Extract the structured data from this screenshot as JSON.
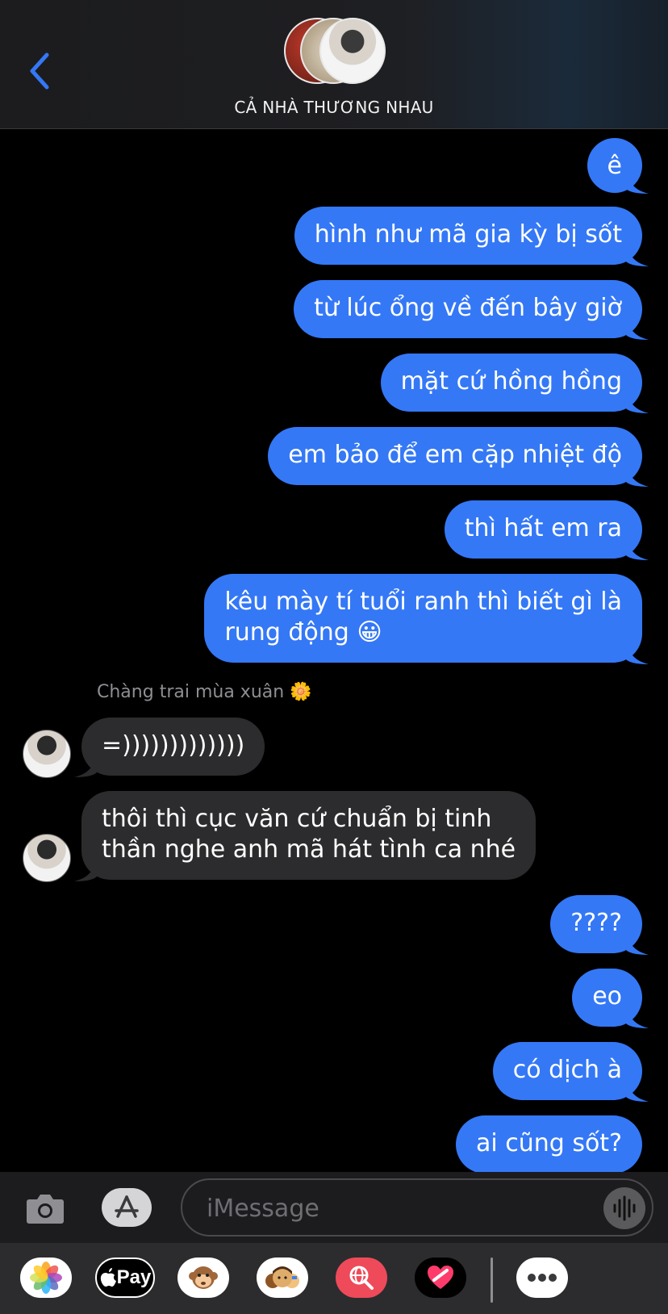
{
  "header": {
    "title": "CẢ NHÀ THƯƠNG NHAU"
  },
  "messages": [
    {
      "dir": "out",
      "text": "ê"
    },
    {
      "dir": "out",
      "text": "hình như mã gia kỳ bị sốt"
    },
    {
      "dir": "out",
      "text": "từ lúc ổng về đến bây giờ"
    },
    {
      "dir": "out",
      "text": "mặt cứ hồng hồng"
    },
    {
      "dir": "out",
      "text": "em bảo để em cặp nhiệt độ"
    },
    {
      "dir": "out",
      "text": "thì hất em ra"
    },
    {
      "dir": "out",
      "line1": "kêu mày tí tuổi ranh thì biết gì là",
      "line2": "rung động 😀"
    },
    {
      "dir": "in",
      "text": "=)))))))))))))"
    },
    {
      "dir": "in",
      "line1": "thôi thì cục văn cứ chuẩn bị tinh",
      "line2": "thần nghe anh mã hát tình ca nhé"
    },
    {
      "dir": "out",
      "text": "????"
    },
    {
      "dir": "out",
      "text": "eo"
    },
    {
      "dir": "out",
      "text": "có dịch à"
    },
    {
      "dir": "out",
      "text": "ai cũng sốt?"
    }
  ],
  "sender_name": "Chàng trai mùa xuân 🌼",
  "composer": {
    "placeholder": "iMessage"
  },
  "drawer": {
    "pay_label": "Pay"
  },
  "colors": {
    "outgoing": "#3478f6",
    "incoming": "#2c2c2e",
    "accent": "#3478f6"
  },
  "icons": [
    "back-chevron-icon",
    "camera-icon",
    "app-store-icon",
    "audio-waveform-icon",
    "photos-icon",
    "apple-pay-icon",
    "monkey-memoji-icon",
    "memoji-icon",
    "globe-search-icon",
    "heart-sticker-icon",
    "more-icon"
  ]
}
